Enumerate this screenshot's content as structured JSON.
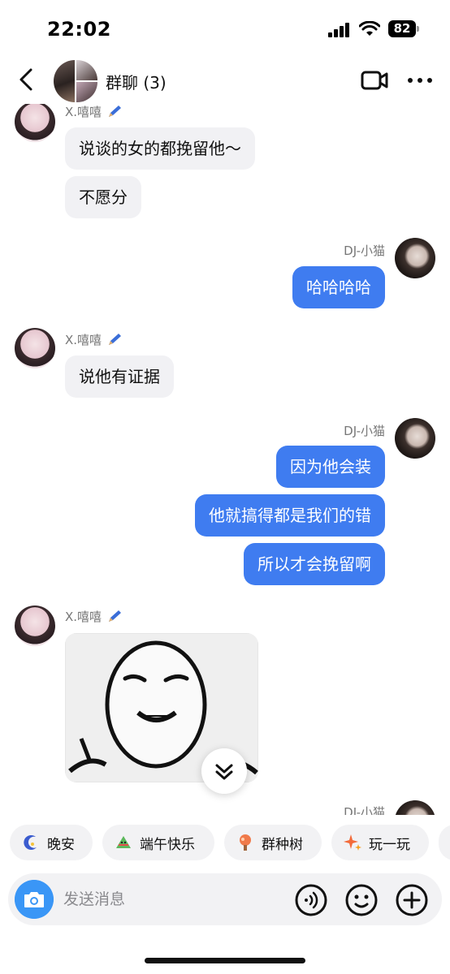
{
  "status_bar": {
    "time": "22:02",
    "battery": "82"
  },
  "header": {
    "back_icon": "chevron-left-icon",
    "title": "群聊 (3)",
    "video_icon": "video-camera-icon",
    "more_icon": "more-dots-icon"
  },
  "messages": [
    {
      "side": "in",
      "sender": "X.嘻嘻",
      "lines": [
        "说谈的女的都挽留他～",
        "不愿分"
      ]
    },
    {
      "side": "out",
      "sender": "DJ-小猫",
      "lines": [
        "哈哈哈哈"
      ]
    },
    {
      "side": "in",
      "sender": "X.嘻嘻",
      "lines": [
        "说他有证据"
      ]
    },
    {
      "side": "out",
      "sender": "DJ-小猫",
      "lines": [
        "因为他会装",
        "他就搞得都是我们的错",
        "所以才会挽留啊"
      ]
    },
    {
      "side": "in",
      "sender": "X.嘻嘻",
      "type": "sticker"
    },
    {
      "side": "out",
      "sender": "DJ-小猫"
    }
  ],
  "quick_chips": [
    {
      "label": "晚安",
      "icon": "moon-icon"
    },
    {
      "label": "端午快乐",
      "icon": "zongzi-icon"
    },
    {
      "label": "群种树",
      "icon": "tree-icon"
    },
    {
      "label": "玩一玩",
      "icon": "sparkle-icon"
    }
  ],
  "input": {
    "placeholder": "发送消息",
    "camera_icon": "camera-icon",
    "voice_icon": "voice-icon",
    "emoji_icon": "emoji-icon",
    "plus_icon": "plus-icon"
  },
  "colors": {
    "outgoing_bubble": "#3f7cf0",
    "incoming_bubble": "#f1f1f4",
    "camera_button": "#3a96f6"
  }
}
